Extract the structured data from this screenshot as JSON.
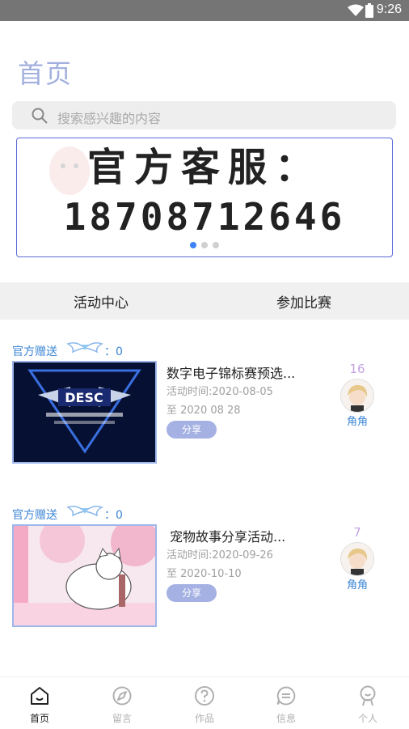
{
  "status_bar": {
    "time": "9:26",
    "icons": [
      "wifi-icon",
      "battery-icon"
    ]
  },
  "page": {
    "title": "首页"
  },
  "search": {
    "placeholder": "搜索感兴趣的内容"
  },
  "banner": {
    "line1": "官方客服：",
    "line2": "18708712646",
    "dots": 3,
    "active_dot": 0
  },
  "tabs": [
    {
      "label": "活动中心"
    },
    {
      "label": "参加比赛"
    }
  ],
  "cards": [
    {
      "tag": "官方赠送",
      "wing_count": "：0",
      "title": "数字电子锦标赛预选...",
      "time_start": "活动时间:2020-08-05",
      "time_end": "至 2020 08 28",
      "share": "分享",
      "count": "16",
      "author": "角角",
      "thumb_text": "DESC"
    },
    {
      "tag": "官方赠送",
      "wing_count": "：0",
      "title": "宠物故事分享活动...",
      "time_start": "活动时间:2020-09-26",
      "time_end": "至 2020-10-10",
      "share": "分享",
      "count": "7",
      "author": "角角"
    }
  ],
  "bottom_nav": [
    {
      "label": "首页",
      "icon": "home-icon",
      "active": true
    },
    {
      "label": "留言",
      "icon": "compass-icon",
      "active": false
    },
    {
      "label": "作品",
      "icon": "question-icon",
      "active": false
    },
    {
      "label": "信息",
      "icon": "chat-icon",
      "active": false
    },
    {
      "label": "个人",
      "icon": "person-icon",
      "active": false
    }
  ],
  "colors": {
    "accent": "#a3b0de",
    "tag_blue": "#3c86d6",
    "share_bg": "#a5b1e3",
    "count_purple": "#c4a3e6",
    "banner_border": "#5b6ad9"
  }
}
